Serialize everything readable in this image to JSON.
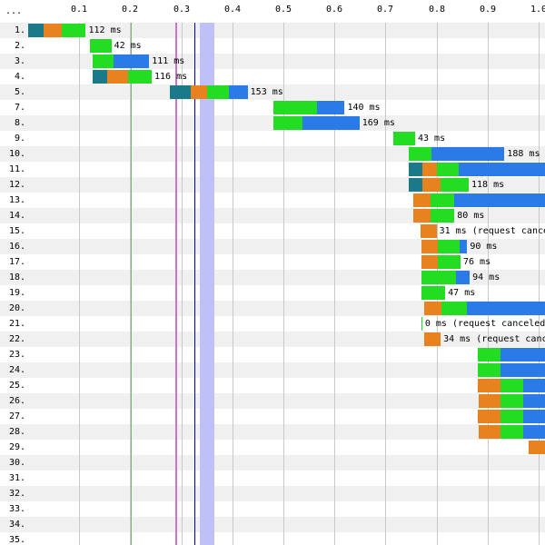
{
  "header": {
    "ellipsis": "...",
    "ticks": [
      "0.1",
      "0.2",
      "0.3",
      "0.4",
      "0.5",
      "0.6",
      "0.7",
      "0.8",
      "0.9",
      "1.0"
    ]
  },
  "scale": {
    "start_s": 0.0,
    "end_s": 1.015,
    "tick_step_s": 0.1
  },
  "colors": {
    "dns": "#1a7a8a",
    "connect": "#e8821e",
    "ttfb": "#22dd22",
    "download": "#2a7ae8",
    "row_alt": "#f0f0f0",
    "gridline": "#c8c8c8",
    "start_render": "#008000",
    "dom_content_loaded": "#d070d0",
    "dom_interactive": "#0000a0",
    "on_load_band": "#c0c0f8"
  },
  "markers": [
    {
      "name": "start-render-marker",
      "t": 0.201,
      "color": "#7ab87a",
      "width_s": 0.002
    },
    {
      "name": "dom-content-loaded-marker",
      "t": 0.288,
      "color": "#d070d0",
      "width_s": 0.003
    },
    {
      "name": "dom-interactive-marker",
      "t": 0.325,
      "color": "#0000a0",
      "width_s": 0.003
    },
    {
      "name": "on-load-band",
      "t": 0.336,
      "color": "#c0c0f8",
      "width_s": 0.028
    }
  ],
  "rows": [
    {
      "label": "1.",
      "segments": [
        {
          "t": "dns",
          "s": 0.0,
          "e": 0.03
        },
        {
          "t": "connect",
          "s": 0.03,
          "e": 0.065
        },
        {
          "t": "ttfb",
          "s": 0.065,
          "e": 0.113
        }
      ],
      "duration_text": "112 ms"
    },
    {
      "label": "2.",
      "segments": [
        {
          "t": "ttfb",
          "s": 0.121,
          "e": 0.163
        }
      ],
      "duration_text": "42 ms"
    },
    {
      "label": "3.",
      "segments": [
        {
          "t": "ttfb",
          "s": 0.126,
          "e": 0.168
        },
        {
          "t": "download",
          "s": 0.168,
          "e": 0.237
        }
      ],
      "duration_text": "111 ms"
    },
    {
      "label": "4.",
      "segments": [
        {
          "t": "dns",
          "s": 0.126,
          "e": 0.155
        },
        {
          "t": "connect",
          "s": 0.155,
          "e": 0.195
        },
        {
          "t": "ttfb",
          "s": 0.195,
          "e": 0.242
        }
      ],
      "duration_text": "116 ms"
    },
    {
      "label": "5.",
      "segments": [
        {
          "t": "dns",
          "s": 0.278,
          "e": 0.318
        },
        {
          "t": "connect",
          "s": 0.318,
          "e": 0.351
        },
        {
          "t": "ttfb",
          "s": 0.351,
          "e": 0.393
        },
        {
          "t": "download",
          "s": 0.393,
          "e": 0.43
        }
      ],
      "duration_text": "153 ms"
    },
    {
      "label": "7.",
      "segments": [
        {
          "t": "ttfb",
          "s": 0.48,
          "e": 0.565
        },
        {
          "t": "download",
          "s": 0.565,
          "e": 0.62
        }
      ],
      "duration_text": "140 ms"
    },
    {
      "label": "8.",
      "segments": [
        {
          "t": "ttfb",
          "s": 0.48,
          "e": 0.538
        },
        {
          "t": "download",
          "s": 0.538,
          "e": 0.649
        }
      ],
      "duration_text": "169 ms"
    },
    {
      "label": "9.",
      "segments": [
        {
          "t": "ttfb",
          "s": 0.715,
          "e": 0.758
        }
      ],
      "duration_text": "43 ms"
    },
    {
      "label": "10.",
      "segments": [
        {
          "t": "ttfb",
          "s": 0.745,
          "e": 0.79
        },
        {
          "t": "download",
          "s": 0.79,
          "e": 0.933
        }
      ],
      "duration_text": "188 ms"
    },
    {
      "label": "11.",
      "segments": [
        {
          "t": "dns",
          "s": 0.745,
          "e": 0.773
        },
        {
          "t": "connect",
          "s": 0.773,
          "e": 0.8
        },
        {
          "t": "ttfb",
          "s": 0.8,
          "e": 0.843
        },
        {
          "t": "download",
          "s": 0.843,
          "e": 1.015
        }
      ],
      "duration_text": ""
    },
    {
      "label": "12.",
      "segments": [
        {
          "t": "dns",
          "s": 0.745,
          "e": 0.773
        },
        {
          "t": "connect",
          "s": 0.773,
          "e": 0.808
        },
        {
          "t": "ttfb",
          "s": 0.808,
          "e": 0.863
        }
      ],
      "duration_text": "118 ms"
    },
    {
      "label": "13.",
      "segments": [
        {
          "t": "connect",
          "s": 0.755,
          "e": 0.788
        },
        {
          "t": "ttfb",
          "s": 0.788,
          "e": 0.835
        },
        {
          "t": "download",
          "s": 0.835,
          "e": 1.015
        }
      ],
      "duration_text": ""
    },
    {
      "label": "14.",
      "segments": [
        {
          "t": "connect",
          "s": 0.755,
          "e": 0.788
        },
        {
          "t": "ttfb",
          "s": 0.788,
          "e": 0.835
        }
      ],
      "duration_text": "80 ms"
    },
    {
      "label": "15.",
      "segments": [
        {
          "t": "connect",
          "s": 0.768,
          "e": 0.8
        }
      ],
      "duration_text": "31 ms (request canceled)"
    },
    {
      "label": "16.",
      "segments": [
        {
          "t": "connect",
          "s": 0.77,
          "e": 0.803
        },
        {
          "t": "ttfb",
          "s": 0.803,
          "e": 0.845
        },
        {
          "t": "download",
          "s": 0.845,
          "e": 0.86
        }
      ],
      "duration_text": "90 ms"
    },
    {
      "label": "17.",
      "segments": [
        {
          "t": "connect",
          "s": 0.77,
          "e": 0.803
        },
        {
          "t": "ttfb",
          "s": 0.803,
          "e": 0.847
        }
      ],
      "duration_text": "76 ms"
    },
    {
      "label": "18.",
      "segments": [
        {
          "t": "ttfb",
          "s": 0.77,
          "e": 0.838
        },
        {
          "t": "download",
          "s": 0.838,
          "e": 0.865
        }
      ],
      "duration_text": "94 ms"
    },
    {
      "label": "19.",
      "segments": [
        {
          "t": "ttfb",
          "s": 0.77,
          "e": 0.817
        }
      ],
      "duration_text": "47 ms"
    },
    {
      "label": "20.",
      "segments": [
        {
          "t": "connect",
          "s": 0.775,
          "e": 0.81
        },
        {
          "t": "ttfb",
          "s": 0.81,
          "e": 0.86
        },
        {
          "t": "download",
          "s": 0.86,
          "e": 1.015
        }
      ],
      "duration_text": ""
    },
    {
      "label": "21.",
      "segments": [
        {
          "t": "ttfb",
          "s": 0.77,
          "e": 0.772
        }
      ],
      "duration_text": "0 ms (request canceled)"
    },
    {
      "label": "22.",
      "segments": [
        {
          "t": "connect",
          "s": 0.775,
          "e": 0.808
        }
      ],
      "duration_text": "34 ms (request canceled)"
    },
    {
      "label": "23.",
      "segments": [
        {
          "t": "ttfb",
          "s": 0.88,
          "e": 0.925
        },
        {
          "t": "download",
          "s": 0.925,
          "e": 1.015
        }
      ],
      "duration_text": ""
    },
    {
      "label": "24.",
      "segments": [
        {
          "t": "ttfb",
          "s": 0.88,
          "e": 0.925
        },
        {
          "t": "download",
          "s": 0.925,
          "e": 1.015
        }
      ],
      "duration_text": ""
    },
    {
      "label": "25.",
      "segments": [
        {
          "t": "connect",
          "s": 0.88,
          "e": 0.925
        },
        {
          "t": "ttfb",
          "s": 0.925,
          "e": 0.97
        },
        {
          "t": "download",
          "s": 0.97,
          "e": 1.015
        }
      ],
      "duration_text": ""
    },
    {
      "label": "26.",
      "segments": [
        {
          "t": "connect",
          "s": 0.882,
          "e": 0.925
        },
        {
          "t": "ttfb",
          "s": 0.925,
          "e": 0.97
        },
        {
          "t": "download",
          "s": 0.97,
          "e": 1.015
        }
      ],
      "duration_text": ""
    },
    {
      "label": "27.",
      "segments": [
        {
          "t": "connect",
          "s": 0.88,
          "e": 0.925
        },
        {
          "t": "ttfb",
          "s": 0.925,
          "e": 0.97
        },
        {
          "t": "download",
          "s": 0.97,
          "e": 1.015
        }
      ],
      "duration_text": ""
    },
    {
      "label": "28.",
      "segments": [
        {
          "t": "connect",
          "s": 0.882,
          "e": 0.925
        },
        {
          "t": "ttfb",
          "s": 0.925,
          "e": 0.97
        },
        {
          "t": "download",
          "s": 0.97,
          "e": 1.015
        }
      ],
      "duration_text": ""
    },
    {
      "label": "29.",
      "segments": [
        {
          "t": "connect",
          "s": 0.98,
          "e": 1.015
        }
      ],
      "duration_text": ""
    },
    {
      "label": "30.",
      "segments": [],
      "duration_text": ""
    },
    {
      "label": "31.",
      "segments": [],
      "duration_text": ""
    },
    {
      "label": "32.",
      "segments": [],
      "duration_text": ""
    },
    {
      "label": "33.",
      "segments": [],
      "duration_text": ""
    },
    {
      "label": "34.",
      "segments": [],
      "duration_text": ""
    },
    {
      "label": "35.",
      "segments": [],
      "duration_text": ""
    }
  ]
}
